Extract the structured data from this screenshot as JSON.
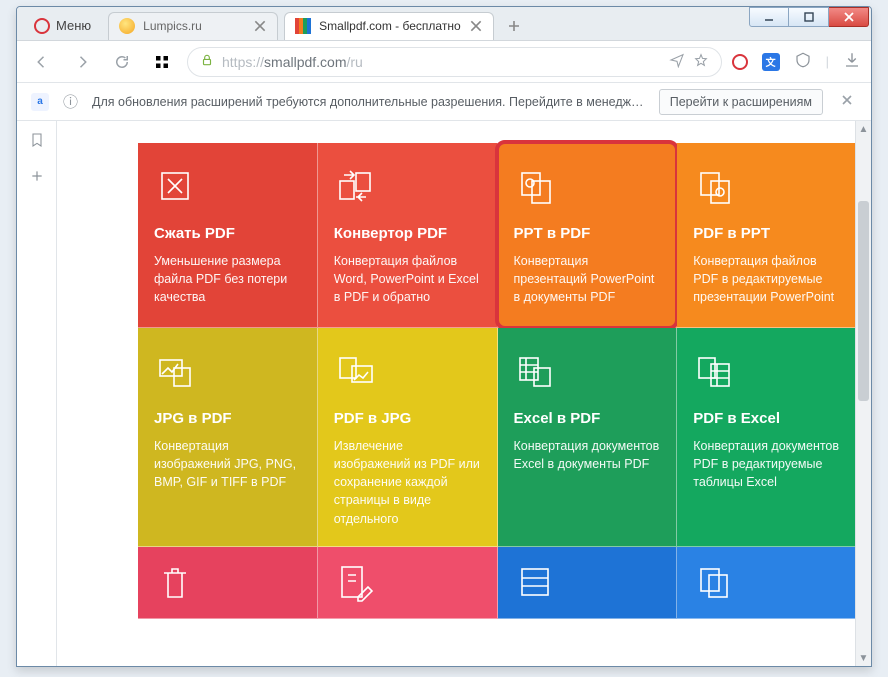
{
  "window": {
    "min": "—",
    "max": "▢",
    "close": "X"
  },
  "menu_label": "Меню",
  "tabs": [
    {
      "title": "Lumpics.ru",
      "active": false
    },
    {
      "title": "Smallpdf.com - бесплатно",
      "active": true
    }
  ],
  "address": {
    "scheme": "https://",
    "host": "smallpdf.com",
    "path": "/ru"
  },
  "notice": {
    "icon": "ⓘ",
    "message": "Для обновления расширений требуются дополнительные разрешения. Перейдите в менедже…",
    "button": "Перейти к расширениям"
  },
  "cards": [
    {
      "id": "compress",
      "title": "Сжать PDF",
      "desc": "Уменьшение размера файла PDF без потери качества",
      "color": "c-red"
    },
    {
      "id": "converter",
      "title": "Конвертор PDF",
      "desc": "Конвертация файлов Word, PowerPoint и Excel в PDF и обратно",
      "color": "c-red2"
    },
    {
      "id": "ppt-to-pdf",
      "title": "PPT в PDF",
      "desc": "Конвертация презентаций PowerPoint в документы PDF",
      "color": "c-orange",
      "highlight": true
    },
    {
      "id": "pdf-to-ppt",
      "title": "PDF в PPT",
      "desc": "Конвертация файлов PDF в редактируемые презентации PowerPoint",
      "color": "c-orange2"
    },
    {
      "id": "jpg-to-pdf",
      "title": "JPG в PDF",
      "desc": "Конвертация изображений JPG, PNG, BMP, GIF и TIFF в PDF",
      "color": "c-olive"
    },
    {
      "id": "pdf-to-jpg",
      "title": "PDF в JPG",
      "desc": "Извлечение изображений из PDF или сохранение каждой страницы в виде отдельного",
      "color": "c-yellow"
    },
    {
      "id": "excel-to-pdf",
      "title": "Excel в PDF",
      "desc": "Конвертация документов Excel в документы PDF",
      "color": "c-green"
    },
    {
      "id": "pdf-to-excel",
      "title": "PDF в Excel",
      "desc": "Конвертация документов PDF в редактируемые таблицы Excel",
      "color": "c-green2"
    }
  ],
  "cards_row3_colors": [
    "c-rose",
    "c-rose2",
    "c-blue",
    "c-blue2"
  ]
}
